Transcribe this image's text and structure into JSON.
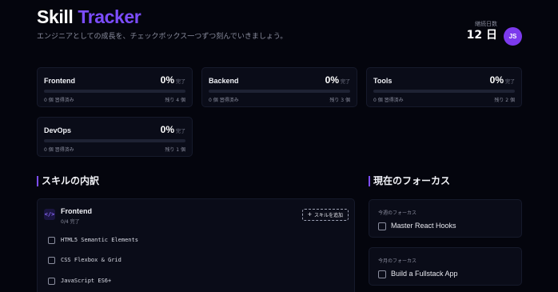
{
  "header": {
    "brand_part1": "Skill",
    "brand_part2": "Tracker",
    "subtitle": "エンジニアとしての成長を、チェックボックス一つずつ刻んでいきましょう。",
    "streak_label": "継続日数",
    "streak_value": "12 日",
    "avatar_initials": "JS"
  },
  "categories": [
    {
      "name": "Frontend",
      "percent": "0%",
      "unit": "完了",
      "progress": 0,
      "done": "0 個 習得済み",
      "left": "残り 4 個"
    },
    {
      "name": "Backend",
      "percent": "0%",
      "unit": "完了",
      "progress": 0,
      "done": "0 個 習得済み",
      "left": "残り 3 個"
    },
    {
      "name": "Tools",
      "percent": "0%",
      "unit": "完了",
      "progress": 0,
      "done": "0 個 習得済み",
      "left": "残り 2 個"
    },
    {
      "name": "DevOps",
      "percent": "0%",
      "unit": "完了",
      "progress": 0,
      "done": "0 個 習得済み",
      "left": "残り 1 個"
    }
  ],
  "breakdown": {
    "title": "スキルの内訳",
    "panel": {
      "icon": "</>",
      "title": "Frontend",
      "sub": "0/4 完了",
      "add_label": "スキルを追加",
      "skills": [
        "HTML5 Semantic Elements",
        "CSS Flexbox & Grid",
        "JavaScript ES6+"
      ]
    }
  },
  "focus": {
    "title": "現在のフォーカス",
    "items": [
      {
        "label": "今週のフォーカス",
        "text": "Master React Hooks"
      },
      {
        "label": "今月のフォーカス",
        "text": "Build a Fullstack App"
      }
    ]
  },
  "colors": {
    "accent": "#7c4dff",
    "background": "#04050d",
    "card": "#0a0c18",
    "avatar": "#7c3aed"
  }
}
